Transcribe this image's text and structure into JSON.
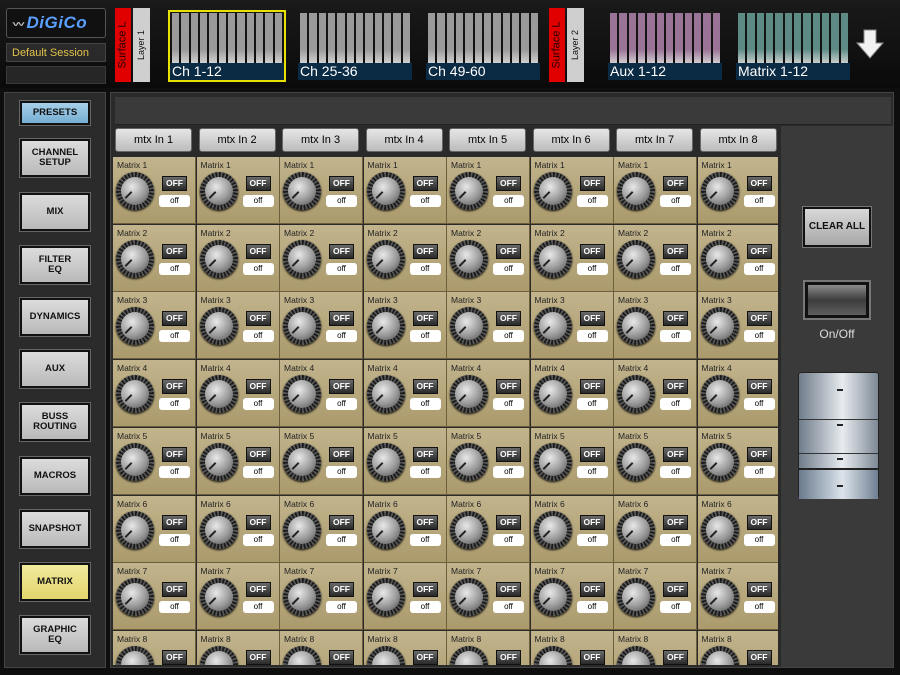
{
  "app": {
    "logo": "DiGiCo",
    "session": "Default Session"
  },
  "topbar": {
    "surfaces": [
      {
        "surface": "Surface L",
        "layer": "Layer 1",
        "banks": [
          {
            "label": "Ch 1-12",
            "active": true,
            "color": "#9a9a9a"
          },
          {
            "label": "Ch 25-36",
            "active": false,
            "color": "#9a9a9a"
          },
          {
            "label": "Ch 49-60",
            "active": false,
            "color": "#9a9a9a"
          }
        ]
      },
      {
        "surface": "Surface L",
        "layer": "Layer 2",
        "banks": [
          {
            "label": "Aux 1-12",
            "active": false,
            "color": "#9a7396"
          },
          {
            "label": "Matrix 1-12",
            "active": false,
            "color": "#5e8a86"
          }
        ]
      }
    ],
    "arrow_icon": "arrow-down-icon"
  },
  "sidebar": {
    "items": [
      {
        "label": "PRESETS",
        "name": "presets"
      },
      {
        "label": "CHANNEL\nSETUP",
        "name": "channel-setup"
      },
      {
        "label": "MIX",
        "name": "mix"
      },
      {
        "label": "FILTER\nEQ",
        "name": "filter-eq"
      },
      {
        "label": "DYNAMICS",
        "name": "dynamics"
      },
      {
        "label": "AUX",
        "name": "aux"
      },
      {
        "label": "BUSS\nROUTING",
        "name": "buss-routing"
      },
      {
        "label": "MACROS",
        "name": "macros"
      },
      {
        "label": "SNAPSHOT",
        "name": "snapshot"
      },
      {
        "label": "MATRIX",
        "name": "matrix"
      },
      {
        "label": "GRAPHIC\nEQ",
        "name": "graphic-eq"
      }
    ],
    "active": "matrix"
  },
  "matrix": {
    "columns": [
      "mtx In 1",
      "mtx In 2",
      "mtx In 3",
      "mtx In 4",
      "mtx In 5",
      "mtx In 6",
      "mtx In 7",
      "mtx In 8"
    ],
    "rows": [
      "Matrix 1",
      "Matrix 2",
      "Matrix 3",
      "Matrix 4",
      "Matrix 5",
      "Matrix 6",
      "Matrix 7",
      "Matrix 8"
    ],
    "button_label": "OFF",
    "state_label": "off"
  },
  "controls": {
    "clear_all": "CLEAR ALL",
    "on_off": "On/Off"
  }
}
